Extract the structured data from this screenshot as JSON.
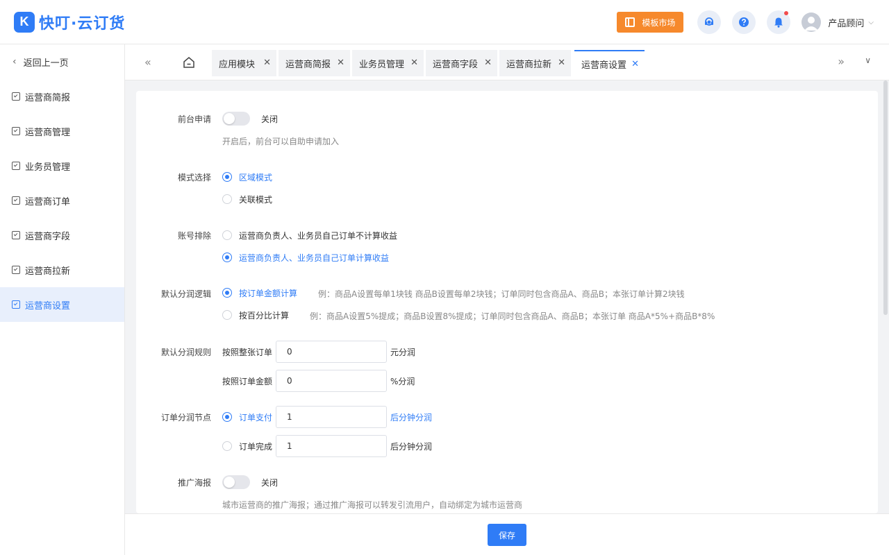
{
  "header": {
    "logo_mark": "K",
    "logo_text": "快叮·云订货",
    "market_button": "模板市场",
    "icons": [
      "headset-icon",
      "help-icon",
      "bell-icon"
    ],
    "user_name": "产品顾问"
  },
  "sidebar": {
    "back": "返回上一页",
    "items": [
      {
        "label": "运营商简报"
      },
      {
        "label": "运营商管理"
      },
      {
        "label": "业务员管理"
      },
      {
        "label": "运营商订单"
      },
      {
        "label": "运营商字段"
      },
      {
        "label": "运营商拉新"
      },
      {
        "label": "运营商设置",
        "active": true
      }
    ]
  },
  "tabs": [
    {
      "label": "应用模块"
    },
    {
      "label": "运营商简报"
    },
    {
      "label": "业务员管理"
    },
    {
      "label": "运营商字段"
    },
    {
      "label": "运营商拉新"
    },
    {
      "label": "运营商设置",
      "active": true
    }
  ],
  "form": {
    "frontend_apply": {
      "label": "前台申请",
      "state": "关闭",
      "hint": "开启后，前台可以自助申请加入"
    },
    "mode": {
      "label": "模式选择",
      "options": [
        "区域模式",
        "关联模式"
      ],
      "selected": "区域模式"
    },
    "account_exclude": {
      "label": "账号排除",
      "options": [
        "运营商负责人、业务员自己订单不计算收益",
        "运营商负责人、业务员自己订单计算收益"
      ],
      "selected": "运营商负责人、业务员自己订单计算收益"
    },
    "split_logic": {
      "label": "默认分润逻辑",
      "options": [
        {
          "label": "按订单金额计算",
          "example": "例：商品A设置每单1块钱 商品B设置每单2块钱；订单同时包含商品A、商品B；本张订单计算2块钱"
        },
        {
          "label": "按百分比计算",
          "example": "例：商品A设置5%提成；商品B设置8%提成；订单同时包含商品A、商品B；本张订单 商品A*5%+商品B*8%"
        }
      ],
      "selected": "按订单金额计算"
    },
    "split_rule": {
      "label": "默认分润规则",
      "per_order_label": "按照整张订单",
      "per_order_value": "0",
      "per_order_unit": "元分润",
      "amount_label": "按照订单金额",
      "amount_value": "0",
      "amount_unit": "%分润"
    },
    "split_node": {
      "label": "订单分润节点",
      "options": [
        {
          "label": "订单支付",
          "value": "1",
          "unit": "后分钟分润"
        },
        {
          "label": "订单完成",
          "value": "1",
          "unit": "后分钟分润"
        }
      ],
      "selected": "订单支付"
    },
    "poster": {
      "label": "推广海报",
      "state": "关闭",
      "hint": "城市运营商的推广海报；通过推广海报可以转发引流用户，自动绑定为城市运营商"
    }
  },
  "footer": {
    "save": "保存"
  },
  "colors": {
    "primary": "#2f7cf6",
    "orange": "#f6892c",
    "badge_red": "#f24b4b"
  }
}
